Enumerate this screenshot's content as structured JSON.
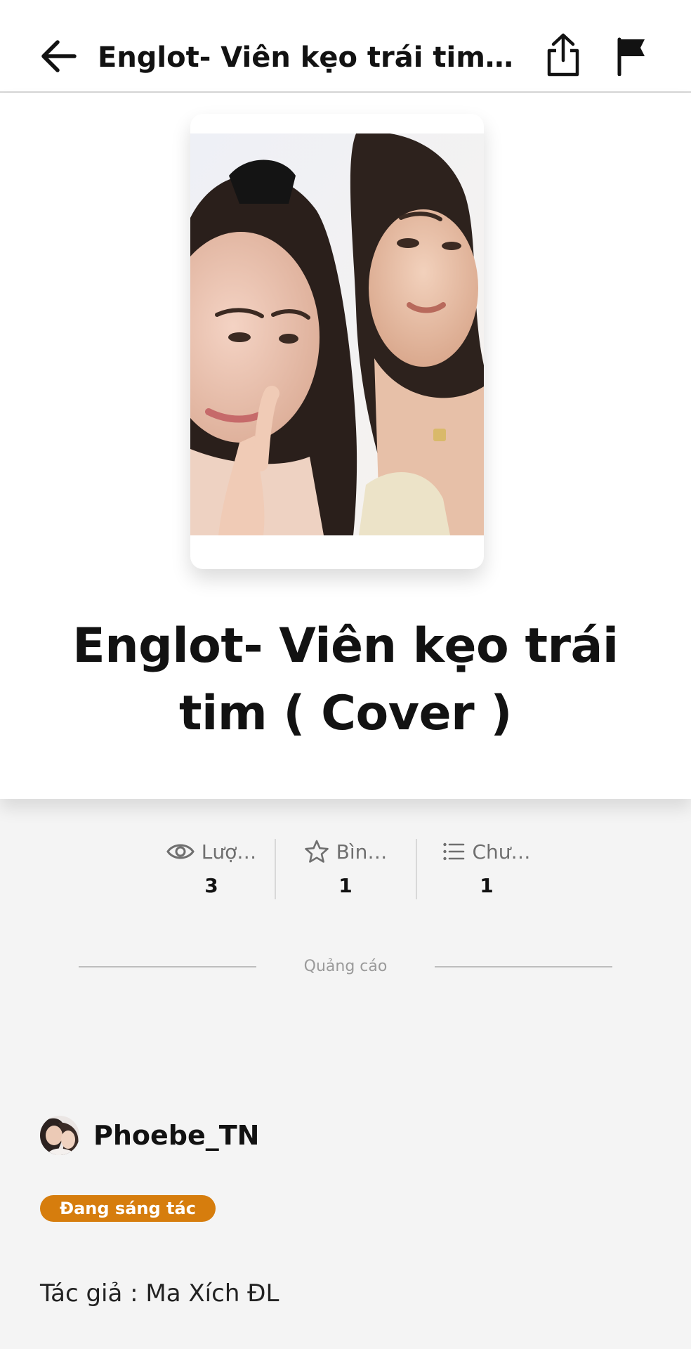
{
  "header": {
    "title": "Englot- Viên kẹo trái tim ( Cover )",
    "back_icon": "arrow-left-icon",
    "share_icon": "share-icon",
    "report_icon": "flag-icon"
  },
  "story": {
    "cover_icon": "cover-image",
    "title": "Englot- Viên kẹo trái tim ( Cover )"
  },
  "stats": [
    {
      "icon": "eye-icon",
      "label": "Lượ…",
      "value": "3"
    },
    {
      "icon": "star-icon",
      "label": "Bìn…",
      "value": "1"
    },
    {
      "icon": "list-icon",
      "label": "Chư…",
      "value": "1"
    }
  ],
  "ad": {
    "label": "Quảng cáo"
  },
  "author": {
    "name": "Phoebe_TN",
    "avatar_icon": "avatar-image"
  },
  "status": {
    "label": "Đang sáng tác",
    "color": "#d67d0d"
  },
  "description": {
    "text": "Tác giả : Ma Xích ĐL"
  },
  "colors": {
    "background": "#f4f4f4",
    "card": "#ffffff",
    "accent": "#d67d0d"
  }
}
